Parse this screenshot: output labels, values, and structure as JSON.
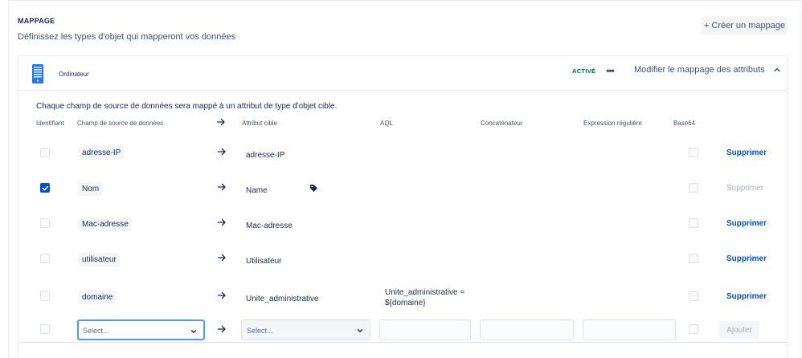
{
  "section": {
    "title": "MAPPAGE",
    "description": "Définissez les types d'objet qui mapperont vos données",
    "create_button": "+ Créer un mappage"
  },
  "card": {
    "name": "Ordinateur",
    "status": "ACTIVÉ",
    "more_icon": "•••",
    "modify_label": "Modifier le mappage des attributs",
    "intro": "Chaque champ de source de données sera mappé à un attribut de type d'objet cible."
  },
  "columns": {
    "identifier": "Identifiant",
    "source_field": "Champ de source de données",
    "target_attribute": "Attribut cible",
    "aql": "AQL",
    "concatenator": "Concaténateur",
    "regex": "Expression régulière",
    "base64": "Base64"
  },
  "rows": [
    {
      "identifier": false,
      "source": "adresse-IP",
      "target": "adresse-IP",
      "aql": "",
      "tag": false,
      "base64": false,
      "delete": "Supprimer",
      "delete_enabled": true
    },
    {
      "identifier": true,
      "source": "Nom",
      "target": "Name",
      "aql": "",
      "tag": true,
      "base64": false,
      "delete": "Supprimer",
      "delete_enabled": false
    },
    {
      "identifier": false,
      "source": "Mac-adresse",
      "target": "Mac-adresse",
      "aql": "",
      "tag": false,
      "base64": false,
      "delete": "Supprimer",
      "delete_enabled": true
    },
    {
      "identifier": false,
      "source": "utilisateur",
      "target": "Utilisateur",
      "aql": "",
      "tag": false,
      "base64": false,
      "delete": "Supprimer",
      "delete_enabled": true
    },
    {
      "identifier": false,
      "source": "domaine",
      "target": "Unite_administrative",
      "aql_line1": "Unite_administrative =",
      "aql_line2": "${domaine}",
      "tag": false,
      "base64": false,
      "delete": "Supprimer",
      "delete_enabled": true
    }
  ],
  "add_row": {
    "source_placeholder": "Select...",
    "target_placeholder": "Select...",
    "add_button": "Ajouter"
  },
  "colors": {
    "primary": "#0052cc",
    "status_green": "#006644",
    "focus": "#4c9aff",
    "text": "#172b4d"
  }
}
